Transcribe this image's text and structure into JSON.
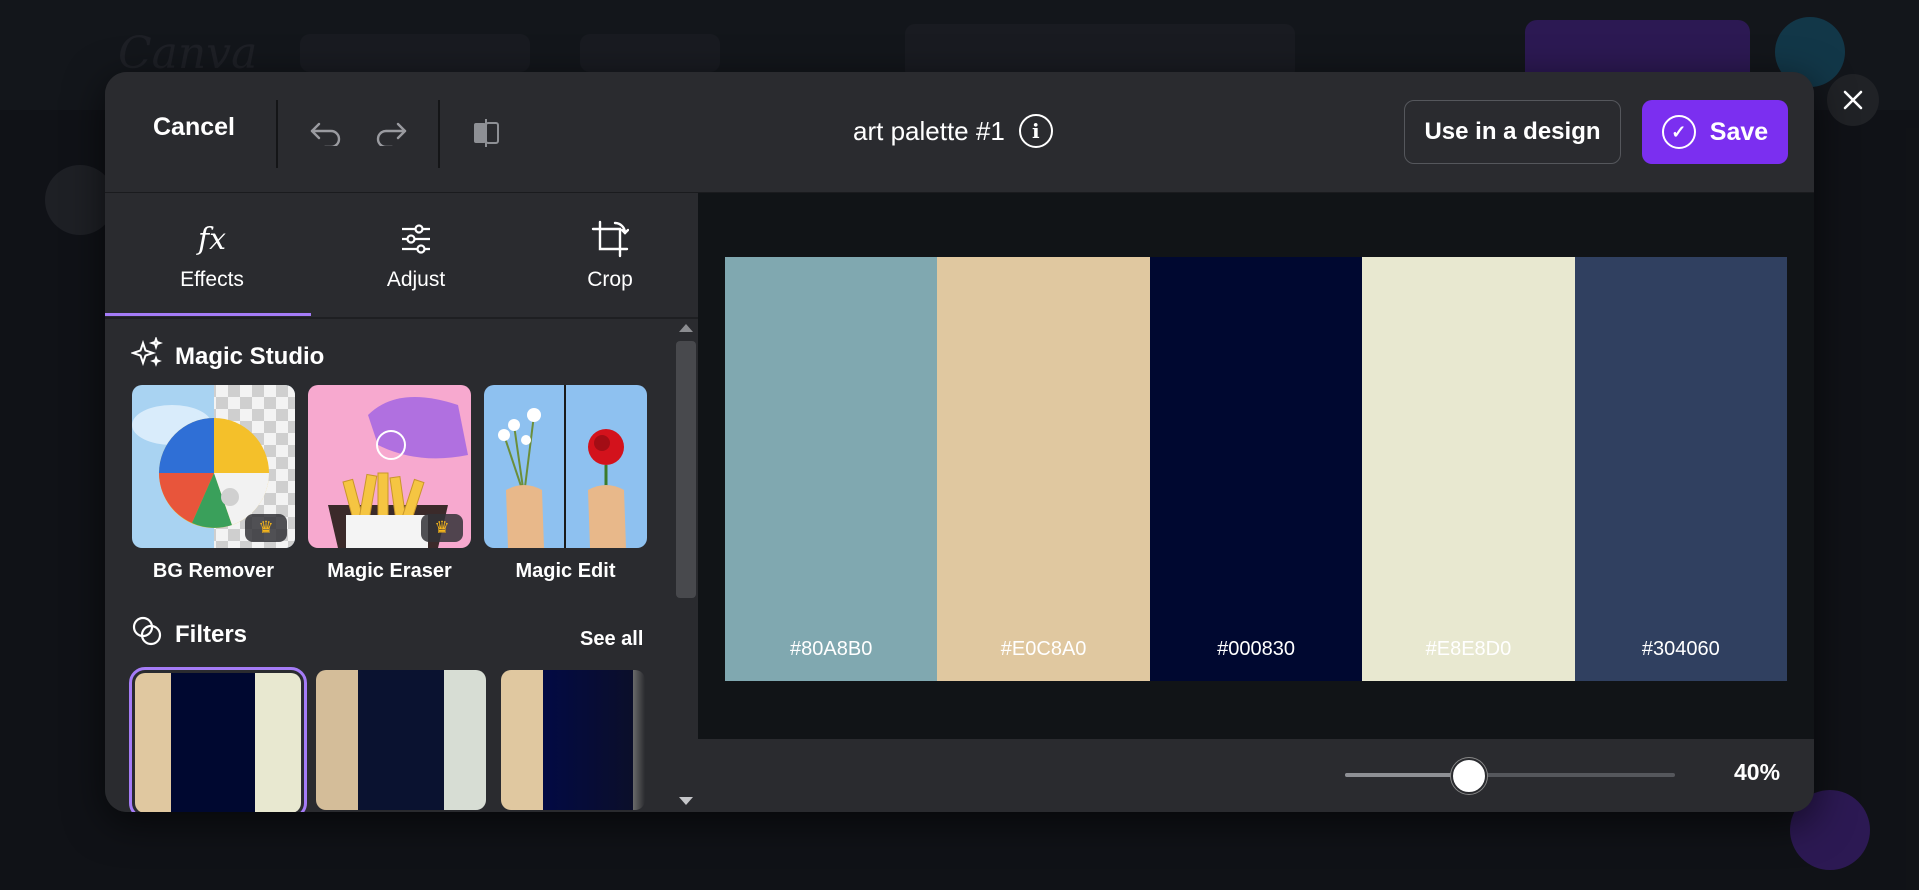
{
  "header": {
    "cancel_label": "Cancel",
    "title": "art palette #1",
    "use_in_design_label": "Use in a design",
    "save_label": "Save"
  },
  "tabs": [
    {
      "label": "Effects",
      "icon": "fx-icon",
      "active": true
    },
    {
      "label": "Adjust",
      "icon": "sliders-icon",
      "active": false
    },
    {
      "label": "Crop",
      "icon": "crop-icon",
      "active": false
    }
  ],
  "magic_studio": {
    "heading": "Magic Studio",
    "tools": [
      {
        "label": "BG Remover",
        "premium": true
      },
      {
        "label": "Magic Eraser",
        "premium": true
      },
      {
        "label": "Magic Edit",
        "premium": false
      }
    ]
  },
  "filters": {
    "heading": "Filters",
    "see_all_label": "See all"
  },
  "palette": [
    {
      "hex": "#80A8B0",
      "color": "#80A8B0",
      "text_color": "#ffffff"
    },
    {
      "hex": "#E0C8A0",
      "color": "#E0C8A0",
      "text_color": "#ffffff"
    },
    {
      "hex": "#000830",
      "color": "#000830",
      "text_color": "#ffffff"
    },
    {
      "hex": "#E8E8D0",
      "color": "#E8E8D0",
      "text_color": "#ffffff"
    },
    {
      "hex": "#304060",
      "color": "#304060",
      "text_color": "#ffffff"
    }
  ],
  "zoom": {
    "label": "40%",
    "value": 40,
    "fraction": 0.37
  },
  "colors": {
    "accent": "#7b2ff0",
    "tab_underline": "#a57cf7",
    "panel": "#2a2b2f",
    "canvas": "#111417"
  }
}
